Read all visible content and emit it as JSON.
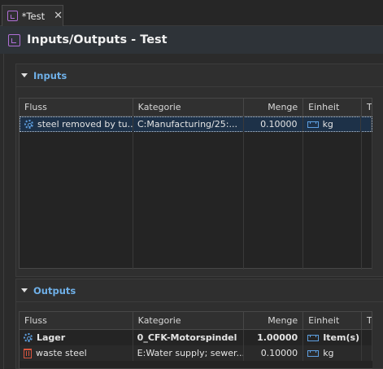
{
  "tab": {
    "label": "*Test",
    "close": "✕"
  },
  "header": {
    "title": "Inputs/Outputs - Test"
  },
  "inputs": {
    "title": "Inputs",
    "columns": [
      "Fluss",
      "Kategorie",
      "Menge",
      "Einheit",
      "T"
    ],
    "rows": [
      {
        "flow": "steel removed by tu...",
        "category": "C:Manufacturing/25:...",
        "amount": "0.10000",
        "unit": "kg",
        "icon": "gear-icon",
        "selected": true
      }
    ]
  },
  "outputs": {
    "title": "Outputs",
    "columns": [
      "Fluss",
      "Kategorie",
      "Menge",
      "Einheit",
      "T"
    ],
    "rows": [
      {
        "flow": "Lager",
        "category": "0_CFK-Motorspindel",
        "amount": "1.00000",
        "unit": "Item(s)",
        "icon": "gear-icon",
        "bold": true
      },
      {
        "flow": "waste steel",
        "category": "E:Water supply; sewer...",
        "amount": "0.10000",
        "unit": "kg",
        "icon": "trash-icon"
      }
    ]
  },
  "colors": {
    "accent": "#6fb0e8",
    "selection": "#1d3148",
    "process_icon": "#b06fd6"
  }
}
